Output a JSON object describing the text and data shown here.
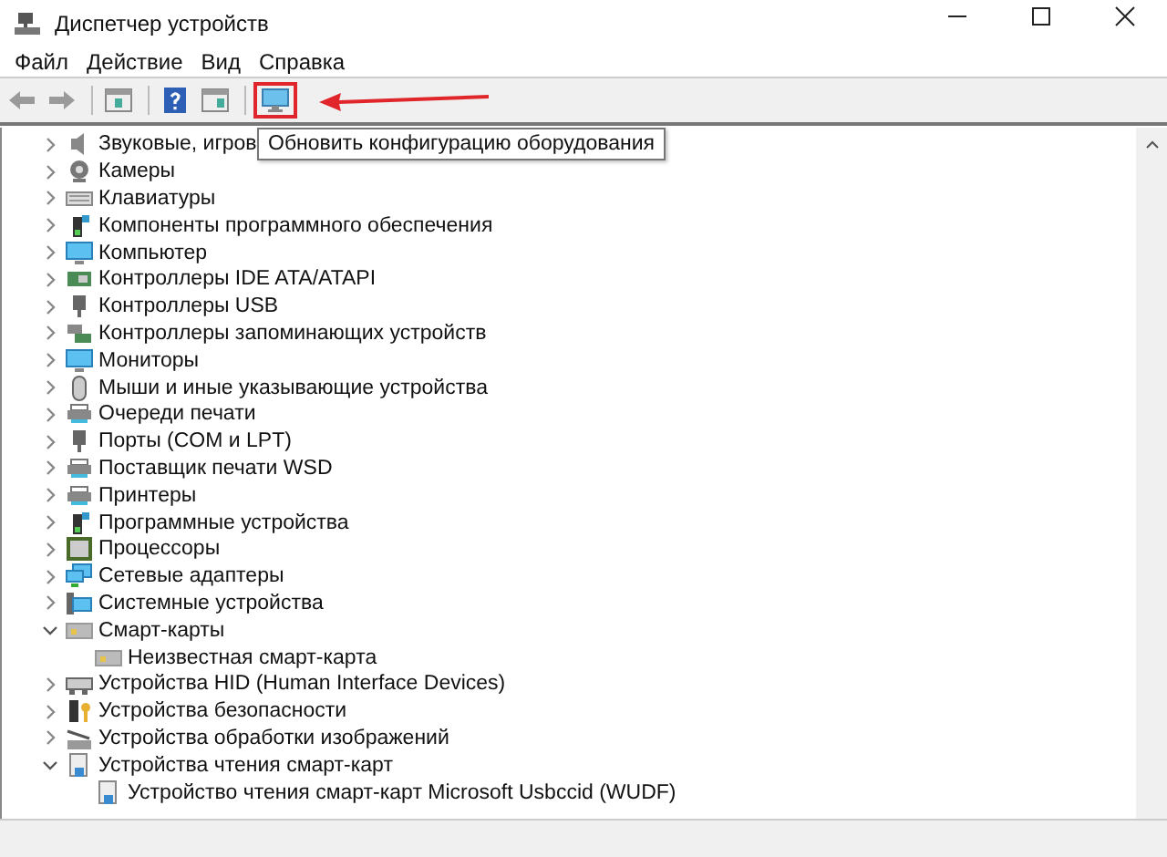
{
  "window": {
    "title": "Диспетчер устройств"
  },
  "menu": [
    "Файл",
    "Действие",
    "Вид",
    "Справка"
  ],
  "toolbar": [
    {
      "kind": "back",
      "highlighted": false
    },
    {
      "kind": "forward",
      "highlighted": false
    },
    {
      "kind": "properties",
      "highlighted": false
    },
    {
      "kind": "help",
      "highlighted": false
    },
    {
      "kind": "view",
      "highlighted": false
    },
    {
      "kind": "scan",
      "highlighted": true
    }
  ],
  "tooltip": "Обновить конфигурацию оборудования",
  "tree": [
    {
      "label": "Звуковые, игров",
      "kind": "speaker",
      "expanded": false
    },
    {
      "label": "Камеры",
      "kind": "camera",
      "expanded": false
    },
    {
      "label": "Клавиатуры",
      "kind": "keyboard",
      "expanded": false
    },
    {
      "label": "Компоненты программного обеспечения",
      "kind": "component",
      "expanded": false
    },
    {
      "label": "Компьютер",
      "kind": "monitor",
      "expanded": false
    },
    {
      "label": "Контроллеры IDE ATA/ATAPI",
      "kind": "board",
      "expanded": false
    },
    {
      "label": "Контроллеры USB",
      "kind": "usb",
      "expanded": false
    },
    {
      "label": "Контроллеры запоминающих устройств",
      "kind": "storage",
      "expanded": false
    },
    {
      "label": "Мониторы",
      "kind": "monitor",
      "expanded": false
    },
    {
      "label": "Мыши и иные указывающие устройства",
      "kind": "mouse",
      "expanded": false
    },
    {
      "label": "Очереди печати",
      "kind": "printer",
      "expanded": false
    },
    {
      "label": "Порты (COM и LPT)",
      "kind": "usb",
      "expanded": false
    },
    {
      "label": "Поставщик печати WSD",
      "kind": "printer",
      "expanded": false
    },
    {
      "label": "Принтеры",
      "kind": "printer",
      "expanded": false
    },
    {
      "label": "Программные устройства",
      "kind": "component",
      "expanded": false
    },
    {
      "label": "Процессоры",
      "kind": "chip",
      "expanded": false
    },
    {
      "label": "Сетевые адаптеры",
      "kind": "network",
      "expanded": false
    },
    {
      "label": "Системные устройства",
      "kind": "system",
      "expanded": false
    },
    {
      "label": "Смарт-карты",
      "kind": "card",
      "expanded": true,
      "children": [
        {
          "label": "Неизвестная смарт-карта",
          "kind": "card"
        }
      ]
    },
    {
      "label": "Устройства HID (Human Interface Devices)",
      "kind": "hid",
      "expanded": false
    },
    {
      "label": "Устройства безопасности",
      "kind": "security",
      "expanded": false
    },
    {
      "label": "Устройства обработки изображений",
      "kind": "imaging",
      "expanded": false
    },
    {
      "label": "Устройства чтения смарт-карт",
      "kind": "reader",
      "expanded": true,
      "children": [
        {
          "label": "Устройство чтения смарт-карт Microsoft Usbccid (WUDF)",
          "kind": "reader"
        }
      ]
    }
  ]
}
